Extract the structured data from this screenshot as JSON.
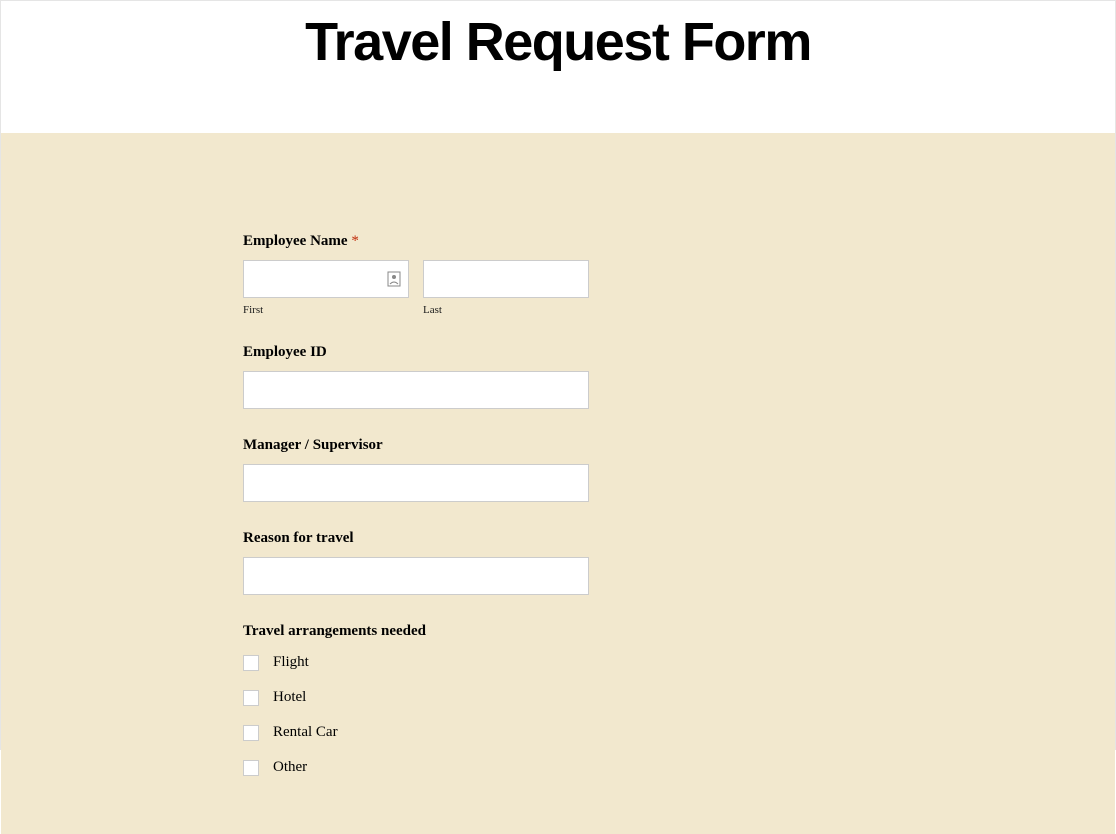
{
  "page": {
    "title": "Travel Request Form"
  },
  "form": {
    "employee_name": {
      "label": "Employee Name",
      "required_marker": "*",
      "first_value": "",
      "first_sublabel": "First",
      "last_value": "",
      "last_sublabel": "Last"
    },
    "employee_id": {
      "label": "Employee ID",
      "value": ""
    },
    "manager": {
      "label": "Manager / Supervisor",
      "value": ""
    },
    "reason": {
      "label": "Reason for travel",
      "value": ""
    },
    "arrangements": {
      "label": "Travel arrangements needed",
      "options": [
        {
          "label": "Flight",
          "checked": false
        },
        {
          "label": "Hotel",
          "checked": false
        },
        {
          "label": "Rental Car",
          "checked": false
        },
        {
          "label": "Other",
          "checked": false
        }
      ]
    }
  }
}
